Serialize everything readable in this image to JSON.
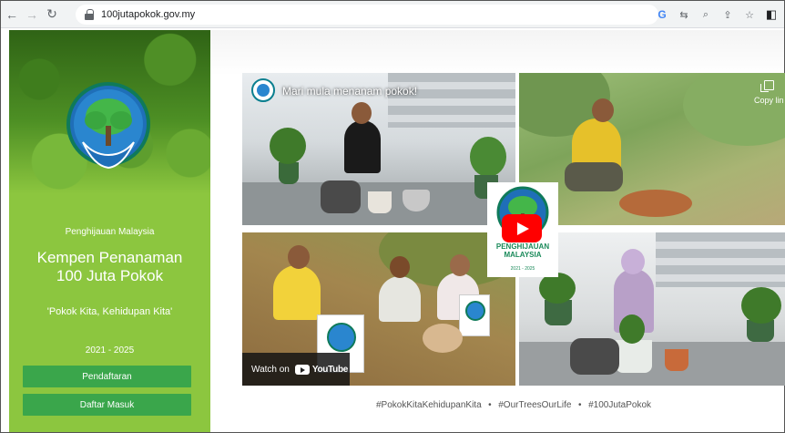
{
  "browser": {
    "url": "100jutapokok.gov.my",
    "nav": {
      "back": "←",
      "forward": "→",
      "reload": "↻"
    },
    "tools": [
      {
        "name": "google-translate-icon",
        "glyph": "G"
      },
      {
        "name": "translate-icon",
        "glyph": "⇆"
      },
      {
        "name": "zoom-icon",
        "glyph": "⌕"
      },
      {
        "name": "share-icon",
        "glyph": "⇪"
      },
      {
        "name": "bookmark-star-icon",
        "glyph": "☆"
      },
      {
        "name": "side-panel-icon",
        "glyph": "◧"
      }
    ]
  },
  "sidebar": {
    "subtitle": "Penghijauan Malaysia",
    "title_line1": "Kempen Penanaman",
    "title_line2": "100 Juta Pokok",
    "slogan": "'Pokok Kita, Kehidupan Kita'",
    "years": "2021 - 2025",
    "register_label": "Pendaftaran",
    "login_label": "Daftar Masuk"
  },
  "video": {
    "title": "Mari mula menanam pokok!",
    "copy_label": "Copy lin",
    "watch_on": "Watch on",
    "youtube_word": "YouTube",
    "center_brand_line1": "PENGHIJAUAN",
    "center_brand_line2": "MALAYSIA",
    "center_years": "2021 - 2025"
  },
  "hashtags": "#PokokKitaKehidupanKita  •  #OurTreesOurLife  •  #100JutaPokok",
  "colors": {
    "sidebar_green": "#8cc63f",
    "button_green": "#3aa64b",
    "youtube_red": "#ff0000"
  }
}
